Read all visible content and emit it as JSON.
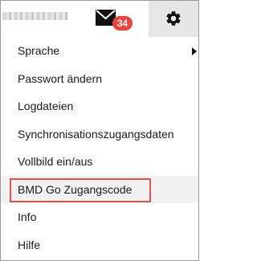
{
  "header": {
    "mail_icon": "envelope-icon",
    "mail_badge": "34",
    "settings_icon": "gear-icon",
    "badge_color": "#e8463c"
  },
  "menu": {
    "items": [
      {
        "label": "Sprache",
        "has_submenu": true
      },
      {
        "label": "Passwort ändern"
      },
      {
        "label": "Logdateien"
      },
      {
        "label": "Synchronisationszugangsdaten"
      },
      {
        "label": "Vollbild ein/aus"
      },
      {
        "label": "BMD Go Zugangscode",
        "highlighted": true
      },
      {
        "label": "Info"
      },
      {
        "label": "Hilfe"
      }
    ],
    "highlight_color": "#d9534f"
  }
}
